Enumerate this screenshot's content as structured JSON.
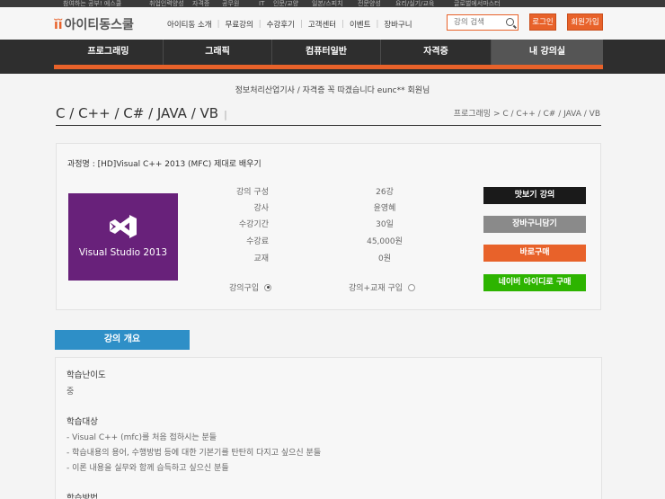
{
  "topstrip": [
    "참여하는 공부! 에스쿨",
    "취업인력양성",
    "자격증",
    "공무원",
    "IT",
    "인문/교양",
    "일본/스피치",
    "전문양성",
    "요리/실기/교육",
    "글로벌에서마스터"
  ],
  "header": {
    "logo_text": "아이티동스쿨",
    "nav": [
      "아이티동 소개",
      "무료강의",
      "수강후기",
      "고객센터",
      "이벤트",
      "장바구니"
    ],
    "search_placeholder": "강의 검색",
    "login_label": "로그인",
    "join_label": "회원가입"
  },
  "mainnav": {
    "tabs": [
      "프로그래밍",
      "그래픽",
      "컴퓨터일반",
      "자격증",
      "내 강의실"
    ],
    "active_index": 4
  },
  "greeting": "정보처리산업기사 / 자격증 꼭 따겠습니다 eunc** 회원님",
  "page": {
    "title": "C / C++ / C# / JAVA / VB",
    "title_bar": "|",
    "breadcrumb": "프로그래밍 > C / C++ / C# / JAVA / VB"
  },
  "course": {
    "name": "과정명 : [HD]Visual C++ 2013 (MFC) 제대로 배우기",
    "thumb_text": "Visual Studio 2013",
    "info": [
      {
        "label": "강의 구성",
        "value": "26강"
      },
      {
        "label": "강사",
        "value": "윤영혜"
      },
      {
        "label": "수강기간",
        "value": "30일"
      },
      {
        "label": "수강료",
        "value": "45,000원"
      },
      {
        "label": "교재",
        "value": "0원"
      }
    ],
    "option_lecture": "강의구입",
    "option_lecture_book": "강의+교재 구입",
    "buttons": {
      "preview": "맛보기 강의",
      "cart": "장바구니담기",
      "buy": "바로구매",
      "naver": "네이버 아이디로 구매"
    }
  },
  "overview": {
    "tab_label": "강의 개요",
    "difficulty_head": "학습난이도",
    "difficulty_value": "중",
    "target_head": "학습대상",
    "target_items": [
      "- Visual C++ (mfc)를 처음 접하시는 분들",
      "- 학습내용의 용어, 수행방법 등에 대한 기본기를 탄탄히 다지고 싶으신 분들",
      "- 이론 내용을 실무와 함께 습득하고 싶으신 분들"
    ],
    "method_head": "학습방법"
  },
  "colors": {
    "accent": "#e8622a",
    "nav_bg": "#2e2e2e",
    "thumb_bg": "#68217a",
    "preview_btn": "#1a1a1a",
    "cart_btn": "#8a8a8a",
    "buy_btn": "#e8622a",
    "naver_btn": "#2db400",
    "overview_tab": "#2e8fc7"
  }
}
